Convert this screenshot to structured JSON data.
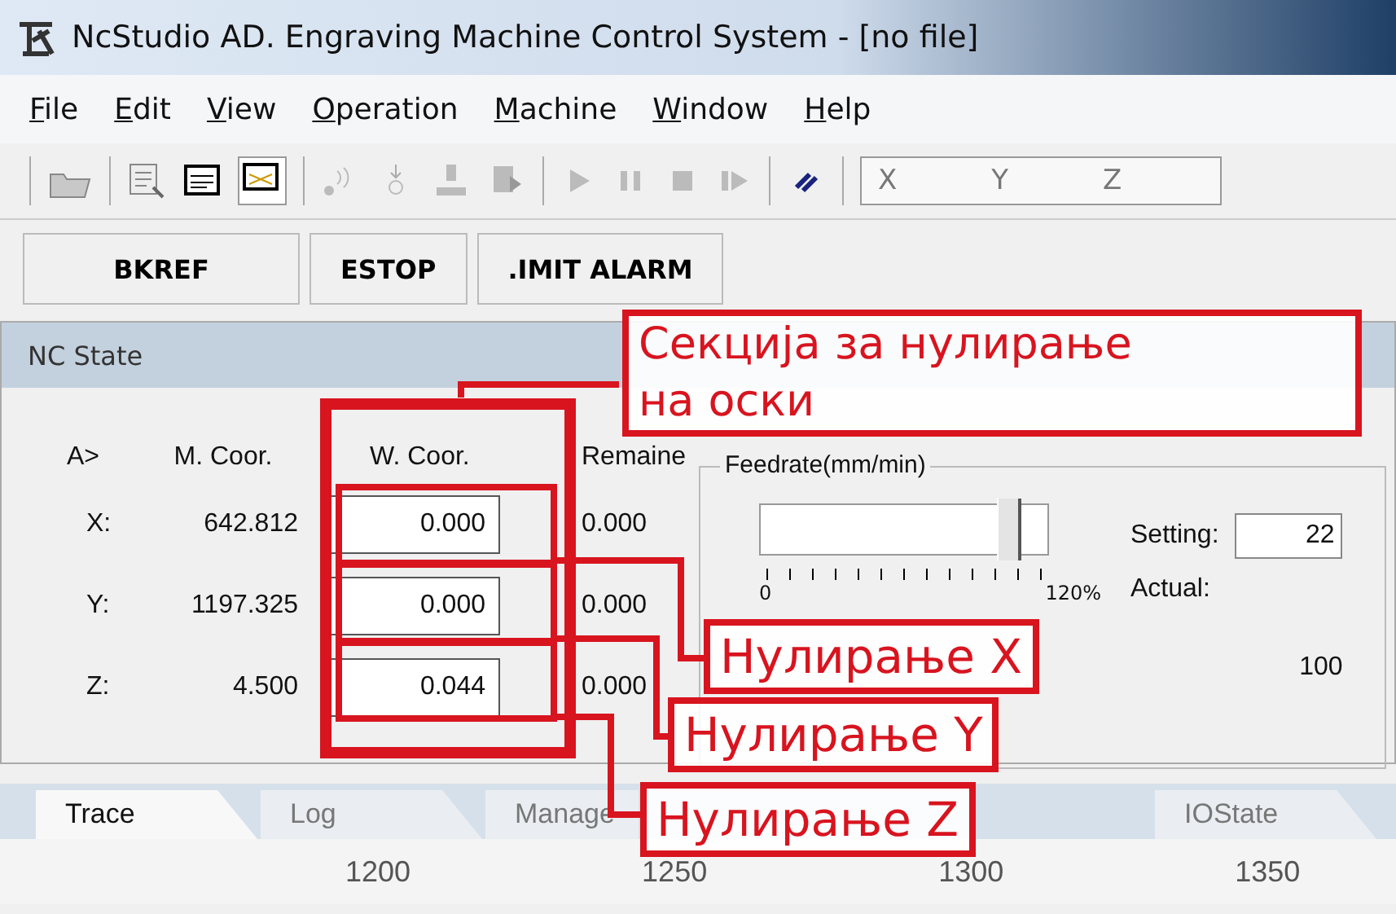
{
  "window": {
    "title": "NcStudio AD. Engraving Machine Control System  - [no file]"
  },
  "menu": [
    "File",
    "Edit",
    "View",
    "Operation",
    "Machine",
    "Window",
    "Help"
  ],
  "toolbar": {
    "coord_labels": [
      "X",
      "Y",
      "Z"
    ]
  },
  "status_buttons": [
    "BKREF",
    "ESTOP",
    ".IMIT ALARM"
  ],
  "nc_state": {
    "title": "NC State",
    "columns": [
      "A>",
      "M. Coor.",
      "W. Coor.",
      "Remaine"
    ],
    "rows": [
      {
        "axis": "X:",
        "machine": "642.812",
        "work": "0.000",
        "remain": "0.000"
      },
      {
        "axis": "Y:",
        "machine": "1197.325",
        "work": "0.000",
        "remain": "0.000"
      },
      {
        "axis": "Z:",
        "machine": "4.500",
        "work": "0.044",
        "remain": "0.000"
      }
    ],
    "feedrate": {
      "title": "Feedrate(mm/min)",
      "level": 0.86,
      "min": "0",
      "max": "120%",
      "setting_label": "Setting:",
      "setting_value": "22",
      "actual_label": "Actual:",
      "actual_value": "100"
    }
  },
  "tabs": [
    {
      "label": "Trace",
      "selected": true
    },
    {
      "label": "Log",
      "selected": false
    },
    {
      "label": "Manage",
      "selected": false
    },
    {
      "label": "IOState",
      "selected": false
    }
  ],
  "ruler": [
    "1200",
    "1250",
    "1300",
    "1350"
  ],
  "annotations": {
    "main": [
      "Секција за нулирање",
      "на оски"
    ],
    "axes": [
      "Нулирање X",
      "Нулирање Y",
      "Нулирање Z"
    ]
  }
}
